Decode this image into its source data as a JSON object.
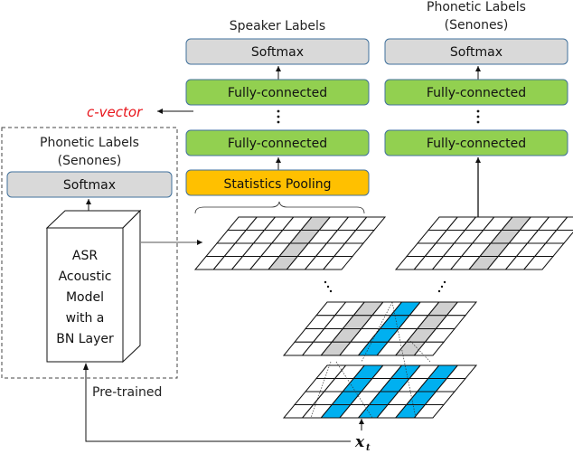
{
  "speaker_branch": {
    "title": "Speaker Labels",
    "softmax": "Softmax",
    "fc_top": "Fully-connected",
    "fc_bottom": "Fully-connected",
    "pooling": "Statistics Pooling",
    "dots": "⋮"
  },
  "phonetic_branch": {
    "title_line1": "Phonetic Labels",
    "title_line2": "(Senones)",
    "softmax": "Softmax",
    "fc_top": "Fully-connected",
    "fc_bottom": "Fully-connected",
    "dots": "⋮"
  },
  "cvector_label": "c-vector",
  "pretrained_box": {
    "title_line1": "Phonetic Labels",
    "title_line2": "(Senones)",
    "softmax": "Softmax",
    "asr_model_lines": [
      "ASR",
      "Acoustic",
      "Model",
      "with a",
      "BN Layer"
    ],
    "caption": "Pre-trained"
  },
  "input_label": "x",
  "input_subscript": "t",
  "colors": {
    "softmax_fill": "#d9d9d9",
    "fc_fill": "#92d050",
    "pooling_fill": "#ffc000",
    "box_border": "#41719c",
    "highlight_gray": "#d0d0d0",
    "highlight_blue": "#00b0f0",
    "cvector_red": "#e8141a"
  },
  "grids": {
    "speaker_grid": {
      "rows": 4,
      "cols": 8,
      "gray_cols": [
        4
      ],
      "blue_cols": []
    },
    "phonetic_grid": {
      "rows": 4,
      "cols": 8,
      "gray_cols": [
        4
      ],
      "blue_cols": []
    },
    "middle_grid": {
      "rows": 4,
      "cols": 8,
      "gray_cols": [
        2,
        6
      ],
      "blue_cols": [
        4
      ]
    },
    "bottom_grid": {
      "rows": 4,
      "cols": 8,
      "gray_cols": [],
      "blue_cols": [
        2,
        4,
        6
      ]
    }
  }
}
